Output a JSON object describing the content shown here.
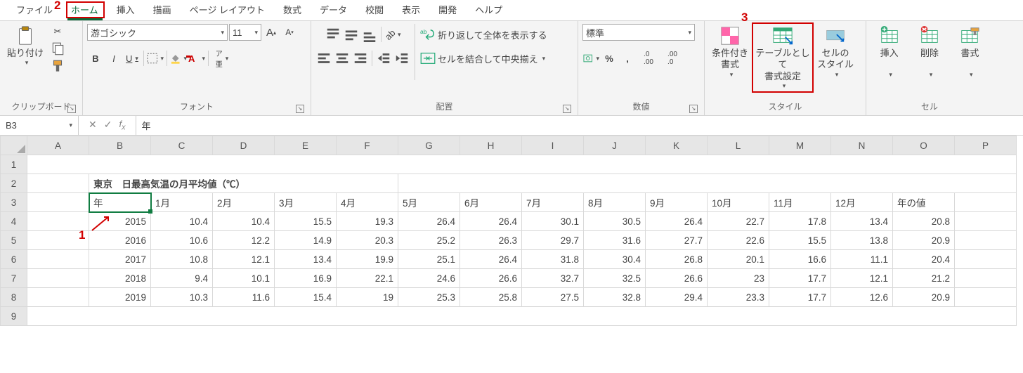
{
  "menu": {
    "items": [
      "ファイル",
      "ホーム",
      "挿入",
      "描画",
      "ページ レイアウト",
      "数式",
      "データ",
      "校閲",
      "表示",
      "開発",
      "ヘルプ"
    ],
    "activeIndex": 1
  },
  "ribbon": {
    "clipboard": {
      "paste": "貼り付け",
      "label": "クリップボード"
    },
    "font": {
      "name": "游ゴシック",
      "size": "11",
      "label": "フォント",
      "bold": "B",
      "italic": "I",
      "underline": "U"
    },
    "alignment": {
      "label": "配置",
      "wrap": "折り返して全体を表示する",
      "merge": "セルを結合して中央揃え"
    },
    "number": {
      "label": "数値",
      "format": "標準"
    },
    "styles": {
      "label": "スタイル",
      "cond": "条件付き\n書式",
      "table": "テーブルとして\n書式設定",
      "cell": "セルの\nスタイル"
    },
    "cells": {
      "label": "セル",
      "insert": "挿入",
      "delete": "削除",
      "format": "書式"
    }
  },
  "namebox": "B3",
  "fx_value": "年",
  "annotations": {
    "a1": "1",
    "a2": "2",
    "a3": "3"
  },
  "cols": [
    "A",
    "B",
    "C",
    "D",
    "E",
    "F",
    "G",
    "H",
    "I",
    "J",
    "K",
    "L",
    "M",
    "N",
    "O",
    "P"
  ],
  "rows": [
    "1",
    "2",
    "3",
    "4",
    "5",
    "6",
    "7",
    "8",
    "9"
  ],
  "title": "東京　日最高気温の月平均値（℃）",
  "headers": [
    "年",
    "1月",
    "2月",
    "3月",
    "4月",
    "5月",
    "6月",
    "7月",
    "8月",
    "9月",
    "10月",
    "11月",
    "12月",
    "年の値"
  ],
  "chart_data": {
    "type": "table",
    "title": "東京　日最高気温の月平均値（℃）",
    "columns": [
      "年",
      "1月",
      "2月",
      "3月",
      "4月",
      "5月",
      "6月",
      "7月",
      "8月",
      "9月",
      "10月",
      "11月",
      "12月",
      "年の値"
    ],
    "rows": [
      {
        "年": 2015,
        "values": [
          10.4,
          10.4,
          15.5,
          19.3,
          26.4,
          26.4,
          30.1,
          30.5,
          26.4,
          22.7,
          17.8,
          13.4,
          20.8
        ]
      },
      {
        "年": 2016,
        "values": [
          10.6,
          12.2,
          14.9,
          20.3,
          25.2,
          26.3,
          29.7,
          31.6,
          27.7,
          22.6,
          15.5,
          13.8,
          20.9
        ]
      },
      {
        "年": 2017,
        "values": [
          10.8,
          12.1,
          13.4,
          19.9,
          25.1,
          26.4,
          31.8,
          30.4,
          26.8,
          20.1,
          16.6,
          11.1,
          20.4
        ]
      },
      {
        "年": 2018,
        "values": [
          9.4,
          10.1,
          16.9,
          22.1,
          24.6,
          26.6,
          32.7,
          32.5,
          26.6,
          23,
          17.7,
          12.1,
          21.2
        ]
      },
      {
        "年": 2019,
        "values": [
          10.3,
          11.6,
          15.4,
          19,
          25.3,
          25.8,
          27.5,
          32.8,
          29.4,
          23.3,
          17.7,
          12.6,
          20.9
        ]
      }
    ]
  }
}
